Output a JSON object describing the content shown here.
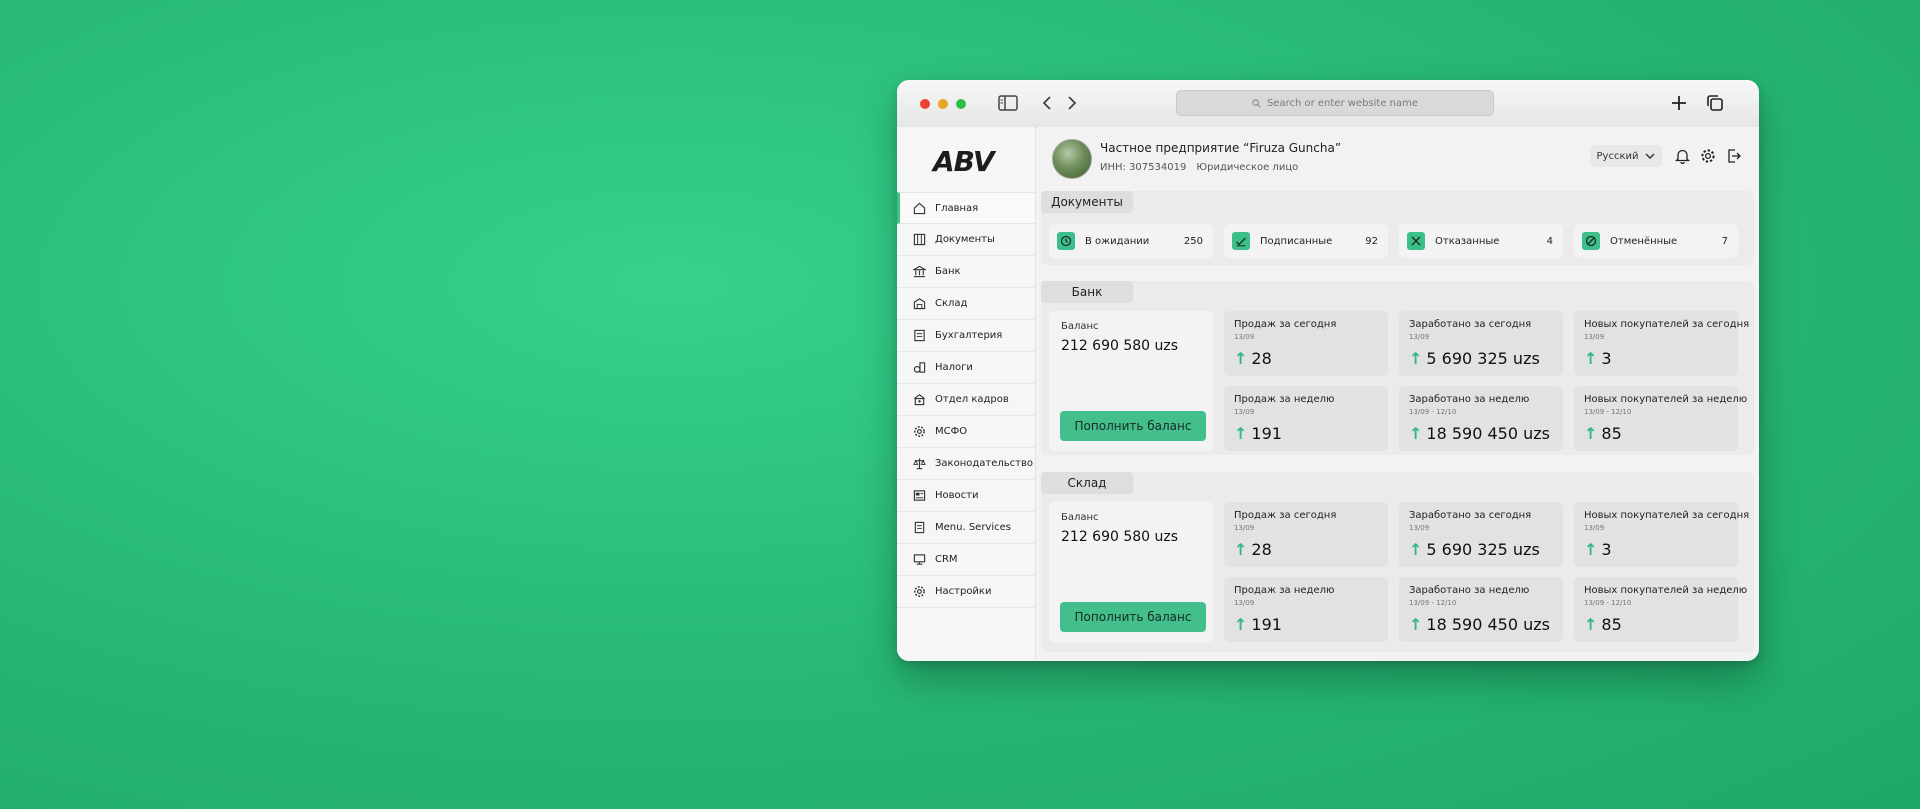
{
  "browser": {
    "search_placeholder": "Search or enter website name"
  },
  "sidebar": {
    "logo": "ABV",
    "items": [
      {
        "label": "Главная",
        "icon": "home-icon"
      },
      {
        "label": "Документы",
        "icon": "documents-icon"
      },
      {
        "label": "Банк",
        "icon": "bank-icon"
      },
      {
        "label": "Склад",
        "icon": "warehouse-icon"
      },
      {
        "label": "Бухгалтерия",
        "icon": "accounting-icon"
      },
      {
        "label": "Налоги",
        "icon": "taxes-icon"
      },
      {
        "label": "Отдел кадров",
        "icon": "hr-icon"
      },
      {
        "label": "МСФО",
        "icon": "gear-icon"
      },
      {
        "label": "Законодательство",
        "icon": "scales-icon"
      },
      {
        "label": "Новости",
        "icon": "news-icon"
      },
      {
        "label": "Menu. Services",
        "icon": "services-icon"
      },
      {
        "label": "CRM",
        "icon": "crm-icon"
      },
      {
        "label": "Настройки",
        "icon": "settings-icon"
      }
    ]
  },
  "header": {
    "company": "Частное предприятие “Firuza Guncha”",
    "inn": "ИНН: 307534019",
    "entity_type": "Юридическое лицо",
    "language": "Русский"
  },
  "documents": {
    "title": "Документы",
    "cards": [
      {
        "label": "В ожидании",
        "count": "250",
        "icon": "clock-icon"
      },
      {
        "label": "Подписанные",
        "count": "92",
        "icon": "signed-icon"
      },
      {
        "label": "Отказанные",
        "count": "4",
        "icon": "x-icon"
      },
      {
        "label": "Отменённые",
        "count": "7",
        "icon": "cancel-icon"
      }
    ]
  },
  "bank": {
    "title": "Банк",
    "balance_label": "Баланс",
    "balance_value": "212 690 580 uzs",
    "topup_label": "Пополнить баланс",
    "stats": [
      {
        "title": "Продаж за сегодня",
        "date": "13/09",
        "value": "28"
      },
      {
        "title": "Заработано за сегодня",
        "date": "13/09",
        "value": "5 690 325 uzs"
      },
      {
        "title": "Новых покупателей за сегодня",
        "date": "13/09",
        "value": "3"
      },
      {
        "title": "Продаж за неделю",
        "date": "13/09",
        "value": "191"
      },
      {
        "title": "Заработано за неделю",
        "date": "13/09 - 12/10",
        "value": "18 590 450 uzs"
      },
      {
        "title": "Новых покупателей за неделю",
        "date": "13/09 - 12/10",
        "value": "85"
      }
    ]
  },
  "warehouse": {
    "title": "Склад",
    "balance_label": "Баланс",
    "balance_value": "212 690 580 uzs",
    "topup_label": "Пополнить баланс",
    "stats": [
      {
        "title": "Продаж за сегодня",
        "date": "13/09",
        "value": "28"
      },
      {
        "title": "Заработано за сегодня",
        "date": "13/09",
        "value": "5 690 325 uzs"
      },
      {
        "title": "Новых покупателей за сегодня",
        "date": "13/09",
        "value": "3"
      },
      {
        "title": "Продаж за неделю",
        "date": "13/09",
        "value": "191"
      },
      {
        "title": "Заработано за неделю",
        "date": "13/09 - 12/10",
        "value": "18 590 450 uzs"
      },
      {
        "title": "Новых покупателей за неделю",
        "date": "13/09 - 12/10",
        "value": "85"
      }
    ]
  },
  "colors": {
    "background": "#2fc27e",
    "accent": "#42bf8c"
  }
}
